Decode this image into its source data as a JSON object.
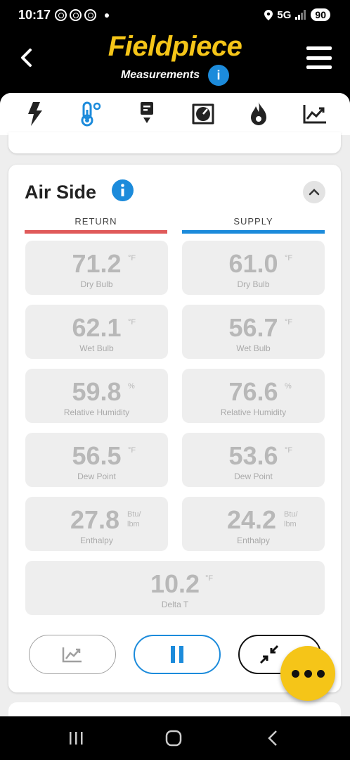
{
  "status_bar": {
    "time": "10:17",
    "network": "5G",
    "battery": "90"
  },
  "header": {
    "logo": "Fieldpiece",
    "subtitle": "Measurements",
    "info_icon": "info-icon"
  },
  "tabs": [
    {
      "icon": "lightning-icon",
      "active": false
    },
    {
      "icon": "thermometer-icon",
      "active": true
    },
    {
      "icon": "probe-download-icon",
      "active": false
    },
    {
      "icon": "gauge-icon",
      "active": false
    },
    {
      "icon": "flame-icon",
      "active": false
    },
    {
      "icon": "trend-chart-icon",
      "active": false
    }
  ],
  "air_side": {
    "title": "Air Side",
    "return_label": "RETURN",
    "supply_label": "SUPPLY",
    "return": [
      {
        "value": "71.2",
        "unit": "°F",
        "label": "Dry Bulb"
      },
      {
        "value": "62.1",
        "unit": "°F",
        "label": "Wet Bulb"
      },
      {
        "value": "59.8",
        "unit": "%",
        "label": "Relative Humidity"
      },
      {
        "value": "56.5",
        "unit": "°F",
        "label": "Dew Point"
      },
      {
        "value": "27.8",
        "unit_line1": "Btu/",
        "unit_line2": "lbm",
        "label": "Enthalpy"
      }
    ],
    "supply": [
      {
        "value": "61.0",
        "unit": "°F",
        "label": "Dry Bulb"
      },
      {
        "value": "56.7",
        "unit": "°F",
        "label": "Wet Bulb"
      },
      {
        "value": "76.6",
        "unit": "%",
        "label": "Relative Humidity"
      },
      {
        "value": "53.6",
        "unit": "°F",
        "label": "Dew Point"
      },
      {
        "value": "24.2",
        "unit_line1": "Btu/",
        "unit_line2": "lbm",
        "label": "Enthalpy"
      }
    ],
    "delta": {
      "value": "10.2",
      "unit": "°F",
      "label": "Delta T"
    }
  },
  "colors": {
    "accent": "#f5c518",
    "blue": "#1c8bdb",
    "return_red": "#e05a5a"
  }
}
